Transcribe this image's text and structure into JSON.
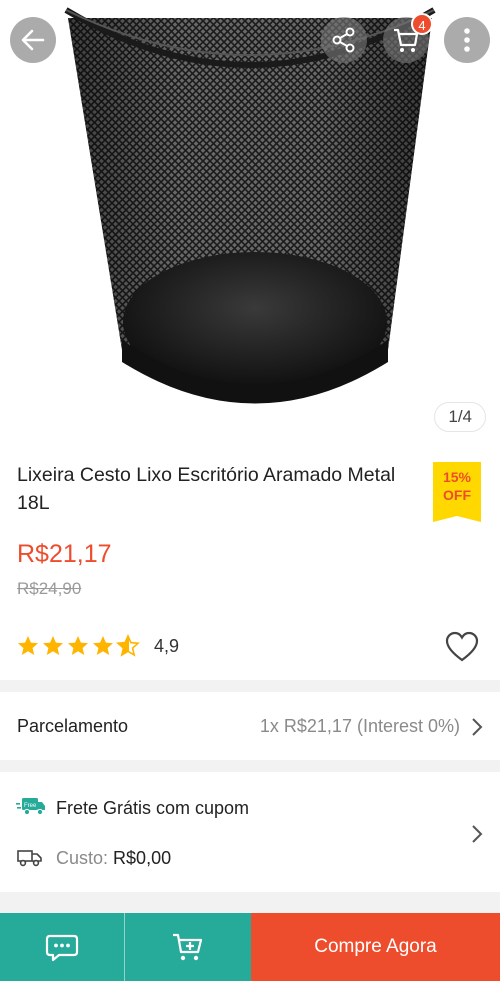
{
  "header": {
    "cart_badge": "4"
  },
  "image": {
    "pager": "1/4"
  },
  "product": {
    "title": "Lixeira Cesto Lixo Escritório Aramado Metal 18L",
    "discount_pct": "15%",
    "discount_off": "OFF",
    "price": "R$21,17",
    "old_price": "R$24,90",
    "rating": "4,9",
    "stars_value": 4.9
  },
  "installments": {
    "label": "Parcelamento",
    "value": "1x R$21,17 (Interest 0%)"
  },
  "shipping": {
    "free_badge": "Free",
    "free_text": "Frete Grátis com cupom",
    "cost_label": "Custo:",
    "cost_value": "R$0,00"
  },
  "bottom_bar": {
    "buy_label": "Compre Agora"
  },
  "colors": {
    "accent": "#ee4d2d",
    "teal": "#26aa99",
    "discount_bg": "#ffd800",
    "star": "#ffb400"
  },
  "icons": [
    "arrow-left-icon",
    "share-icon",
    "cart-icon",
    "more-vertical-icon",
    "star-icon",
    "heart-icon",
    "chevron-right-icon",
    "free-shipping-truck-icon",
    "truck-icon",
    "chat-icon",
    "add-to-cart-icon"
  ]
}
